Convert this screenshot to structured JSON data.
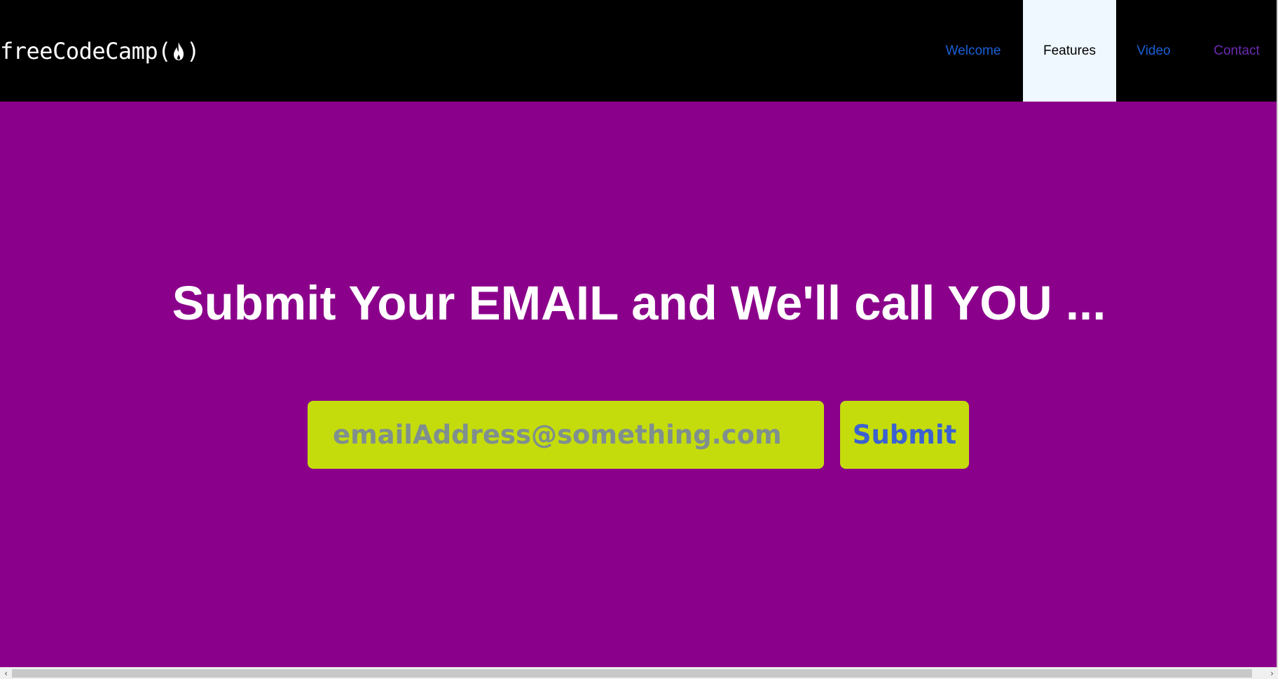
{
  "header": {
    "logo": {
      "text": "freeCodeCamp",
      "open_paren": "(",
      "close_paren": ")",
      "icon": "flame-icon"
    },
    "nav": [
      {
        "label": "Welcome",
        "active": false
      },
      {
        "label": "Features",
        "active": true
      },
      {
        "label": "Video",
        "active": false
      },
      {
        "label": "Contact",
        "active": false
      }
    ]
  },
  "hero": {
    "title": "Submit Your EMAIL and We'll call YOU ...",
    "email_placeholder": "emailAddress@something.com",
    "submit_label": "Submit"
  },
  "scrollbar": {
    "left_arrow": "‹",
    "right_arrow": "›"
  },
  "colors": {
    "navbar_bg": "#000000",
    "hero_bg": "#8b008b",
    "input_bg": "#c4dc0c",
    "active_nav_bg": "#eff8ff",
    "link_color": "#1a5fd6",
    "visited_link_color": "#6a2bb0",
    "submit_text": "#3b62d0"
  }
}
